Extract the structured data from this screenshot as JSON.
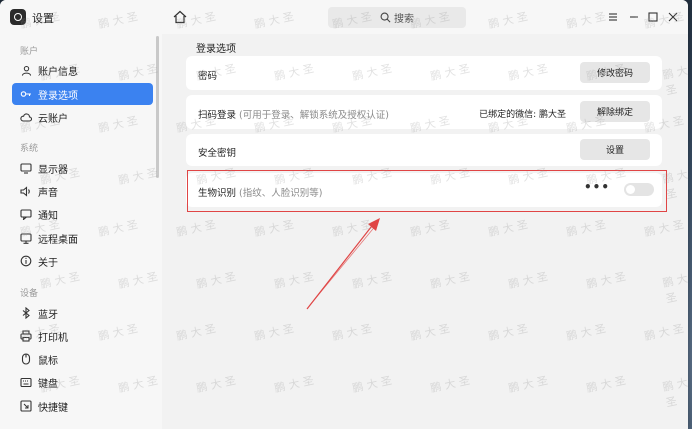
{
  "window": {
    "title": "设置"
  },
  "search": {
    "placeholder": "搜索"
  },
  "sidebar": {
    "sections": [
      {
        "title": "账户",
        "items": [
          {
            "label": "账户信息",
            "icon": "user-icon"
          },
          {
            "label": "登录选项",
            "icon": "key-icon",
            "active": true
          },
          {
            "label": "云账户",
            "icon": "cloud-icon"
          }
        ]
      },
      {
        "title": "系统",
        "items": [
          {
            "label": "显示器",
            "icon": "monitor-icon"
          },
          {
            "label": "声音",
            "icon": "speaker-icon"
          },
          {
            "label": "通知",
            "icon": "notification-icon"
          },
          {
            "label": "远程桌面",
            "icon": "remote-desktop-icon"
          },
          {
            "label": "关于",
            "icon": "info-icon"
          }
        ]
      },
      {
        "title": "设备",
        "items": [
          {
            "label": "蓝牙",
            "icon": "bluetooth-icon"
          },
          {
            "label": "打印机",
            "icon": "printer-icon"
          },
          {
            "label": "鼠标",
            "icon": "mouse-icon"
          },
          {
            "label": "键盘",
            "icon": "keyboard-icon"
          },
          {
            "label": "快捷键",
            "icon": "shortcut-icon"
          }
        ]
      }
    ]
  },
  "main": {
    "section_title": "登录选项",
    "password": {
      "label": "密码",
      "button": "修改密码"
    },
    "qr_login": {
      "label": "扫码登录",
      "hint": "(可用于登录、解锁系统及授权认证)",
      "bound_text": "已绑定的微信: 鹏大圣",
      "button": "解除绑定"
    },
    "security_key": {
      "label": "安全密钥",
      "button": "设置"
    },
    "biometric": {
      "label": "生物识别",
      "hint": "(指纹、人脸识别等)",
      "more": "•••",
      "enabled": false
    }
  },
  "watermark": "鹏 大 圣",
  "colors": {
    "accent": "#3b82f0",
    "annotation": "#e04545"
  }
}
